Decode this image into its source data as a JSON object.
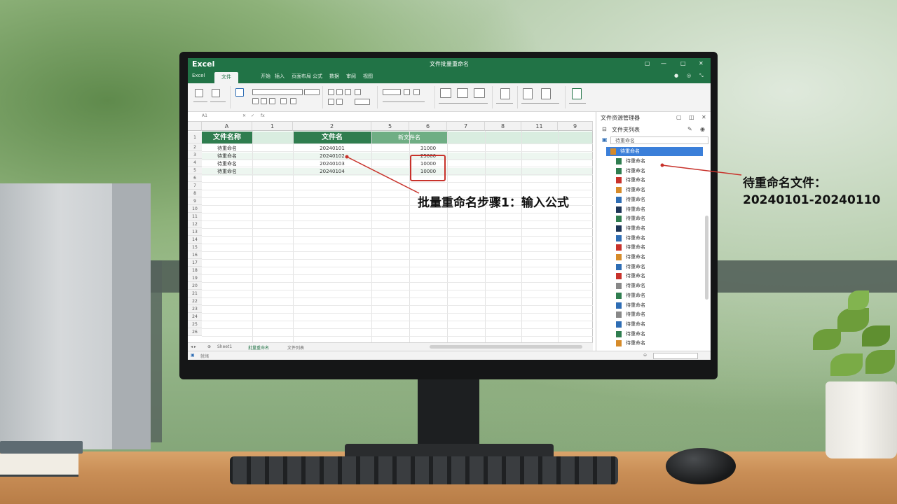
{
  "excel": {
    "app_logo": "Excel",
    "window_title": "文件批量重命名",
    "window_controls": [
      "▢",
      "—",
      "□",
      "✕"
    ],
    "tabs": [
      "Excel",
      "文件",
      "开始",
      "插入",
      "页面布局",
      "公式",
      "数据",
      "审阅",
      "视图"
    ],
    "active_tab": "文件",
    "formula_bar": {
      "name_box": "A1",
      "formula": "fx"
    },
    "columns": [
      "A",
      "1",
      "2",
      "5",
      "6",
      "7",
      "8",
      "11",
      "9"
    ],
    "rows": [
      "1",
      "2",
      "3",
      "4",
      "5",
      "6",
      "7",
      "8",
      "9",
      "10",
      "11",
      "12",
      "13",
      "14",
      "15",
      "16",
      "17",
      "18",
      "19",
      "20",
      "21",
      "22",
      "23",
      "24",
      "25",
      "26"
    ],
    "header_row": [
      "文件名称",
      "文件名",
      "新文件名"
    ],
    "data_rows": [
      [
        "待重命名",
        "20240101",
        "31000"
      ],
      [
        "待重命名",
        "20240102",
        "25000"
      ],
      [
        "待重命名",
        "20240103",
        "10000"
      ],
      [
        "待重命名",
        "20240104",
        "10000"
      ]
    ],
    "sheet_tabs": [
      "Sheet1",
      "批量重命名",
      "文件列表"
    ],
    "status": "就绪"
  },
  "pane": {
    "title": "文件资源管理器",
    "subtitle": "文件夹列表",
    "search_value": "待重命名",
    "selected_item": "待重命名",
    "items": [
      "待重命名",
      "待重命名",
      "待重命名",
      "待重命名",
      "待重命名",
      "待重命名",
      "待重命名",
      "待重命名",
      "待重命名",
      "待重命名",
      "待重命名",
      "待重命名",
      "待重命名",
      "待重命名",
      "待重命名",
      "待重命名",
      "待重命名",
      "待重命名",
      "待重命名",
      "待重命名"
    ],
    "item_colors": [
      "#2f7d4f",
      "#2f7d4f",
      "#c8322b",
      "#d68b2a",
      "#2e6db4",
      "#1d3557",
      "#2f7d4f",
      "#1d3557",
      "#2e6db4",
      "#c8322b",
      "#d68b2a",
      "#2e6db4",
      "#c8322b",
      "#888888",
      "#2f7d4f",
      "#2e6db4",
      "#888888",
      "#2e6db4",
      "#2f7d4f",
      "#d68b2a"
    ]
  },
  "callouts": {
    "step": "批量重命名步骤1：输入公式",
    "files_line1": "待重命名文件：",
    "files_line2": "20240101-20240110"
  },
  "accent_color": "#217346",
  "highlight_color": "#c8322b"
}
